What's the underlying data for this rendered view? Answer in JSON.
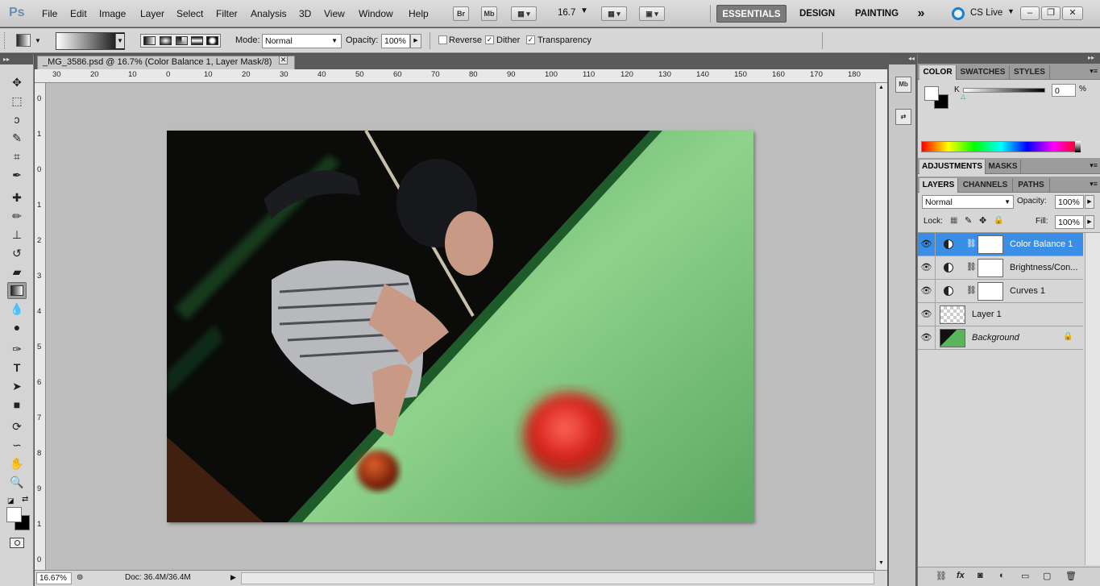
{
  "app": {
    "logo": "Ps",
    "menus": [
      "File",
      "Edit",
      "Image",
      "Layer",
      "Select",
      "Filter",
      "Analysis",
      "3D",
      "View",
      "Window",
      "Help"
    ],
    "bridge": "Br",
    "minibridge": "Mb",
    "zoom_value": "16.7",
    "workspaces": [
      "ESSENTIALS",
      "DESIGN",
      "PAINTING"
    ],
    "more": "»",
    "cs_live": "CS Live"
  },
  "options": {
    "mode_label": "Mode:",
    "mode_value": "Normal",
    "opacity_label": "Opacity:",
    "opacity_value": "100%",
    "reverse_label": "Reverse",
    "dither_label": "Dither",
    "transparency_label": "Transparency",
    "dither_checked": "✓",
    "transparency_checked": "✓"
  },
  "document": {
    "tab_title": "_MG_3586.psd @ 16.7% (Color Balance 1, Layer Mask/8)",
    "close": "✕",
    "ruler_h": [
      "30",
      "20",
      "10",
      "0",
      "10",
      "20",
      "30",
      "40",
      "50",
      "60",
      "70",
      "80",
      "90",
      "100",
      "110",
      "120",
      "130",
      "140",
      "150",
      "160",
      "170",
      "180"
    ],
    "ruler_v": [
      "0",
      "1",
      "0",
      "1",
      "2",
      "3",
      "4",
      "5",
      "6",
      "7",
      "8",
      "9",
      "1",
      "0"
    ]
  },
  "status": {
    "zoom": "16.67%",
    "doc": "Doc: 36.4M/36.4M"
  },
  "color_panel": {
    "tabs": [
      "COLOR",
      "SWATCHES",
      "STYLES"
    ],
    "k_label": "K",
    "k_value": "0",
    "k_unit": "%"
  },
  "adjustments_panel": {
    "tabs": [
      "ADJUSTMENTS",
      "MASKS"
    ]
  },
  "layers_panel": {
    "tabs": [
      "LAYERS",
      "CHANNELS",
      "PATHS"
    ],
    "blend_mode": "Normal",
    "opacity_label": "Opacity:",
    "opacity_value": "100%",
    "lock_label": "Lock:",
    "fill_label": "Fill:",
    "fill_value": "100%",
    "layers": [
      {
        "name": "Color Balance 1",
        "type": "adjustment",
        "selected": true
      },
      {
        "name": "Brightness/Con...",
        "type": "adjustment",
        "selected": false
      },
      {
        "name": "Curves 1",
        "type": "adjustment",
        "selected": false
      },
      {
        "name": "Layer 1",
        "type": "pixel",
        "selected": false
      },
      {
        "name": "Background",
        "type": "background",
        "selected": false
      }
    ]
  },
  "colors": {
    "selection": "#3a8ee6",
    "felt_green": "#6fbf6f"
  }
}
